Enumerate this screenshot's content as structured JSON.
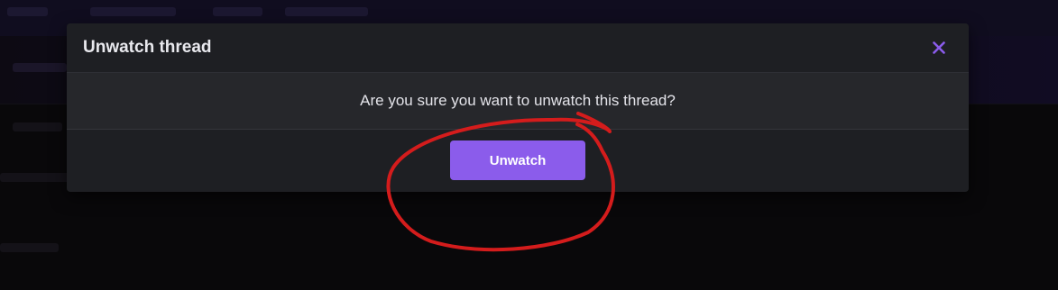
{
  "dialog": {
    "title": "Unwatch thread",
    "close_icon": "close-icon",
    "message": "Are you sure you want to unwatch this thread?",
    "confirm_label": "Unwatch"
  },
  "colors": {
    "accent": "#8b5ceb",
    "close_icon": "#8b5ceb",
    "annotation": "#d41c1c"
  }
}
